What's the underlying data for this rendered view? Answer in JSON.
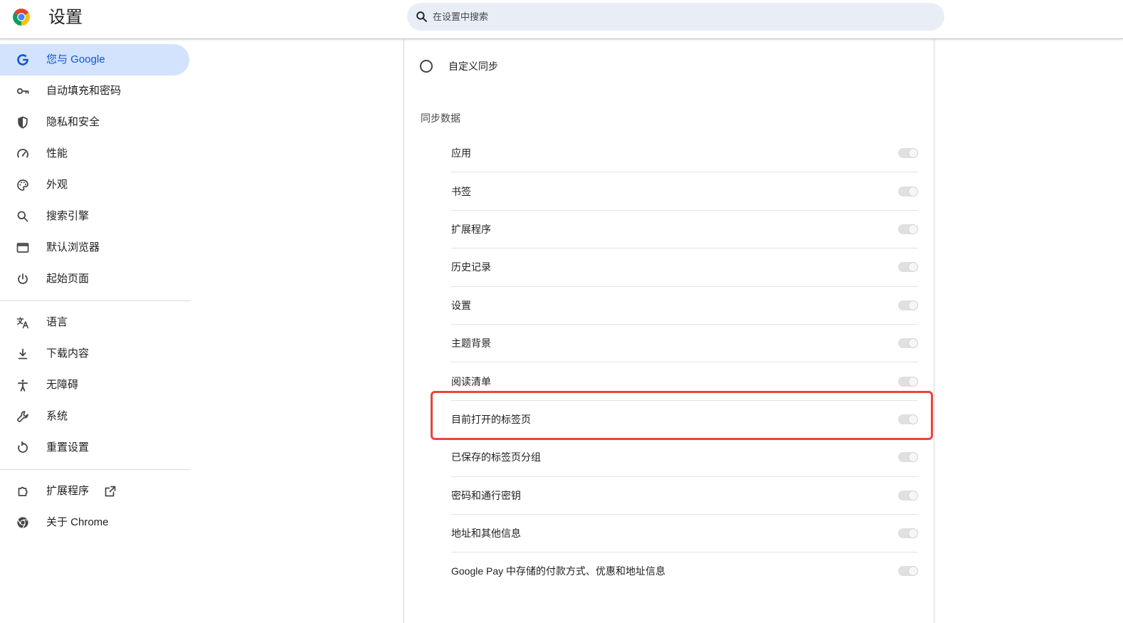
{
  "header": {
    "logo_icon": "chrome-logo-icon",
    "title": "设置",
    "search_icon": "search-icon",
    "search_placeholder": "在设置中搜索"
  },
  "sidebar": {
    "primary": [
      {
        "label": "您与 Google",
        "icon": "google-g-icon",
        "selected": true
      },
      {
        "label": "自动填充和密码",
        "icon": "key-icon",
        "selected": false
      },
      {
        "label": "隐私和安全",
        "icon": "shield-icon",
        "selected": false
      },
      {
        "label": "性能",
        "icon": "gauge-icon",
        "selected": false
      },
      {
        "label": "外观",
        "icon": "palette-icon",
        "selected": false
      },
      {
        "label": "搜索引擎",
        "icon": "search-icon",
        "selected": false
      },
      {
        "label": "默认浏览器",
        "icon": "browser-window-icon",
        "selected": false
      },
      {
        "label": "起始页面",
        "icon": "power-icon",
        "selected": false
      }
    ],
    "secondary": [
      {
        "label": "语言",
        "icon": "translate-icon"
      },
      {
        "label": "下载内容",
        "icon": "download-icon"
      },
      {
        "label": "无障碍",
        "icon": "accessibility-icon"
      },
      {
        "label": "系统",
        "icon": "wrench-icon"
      },
      {
        "label": "重置设置",
        "icon": "reset-icon"
      }
    ],
    "tertiary": [
      {
        "label": "扩展程序",
        "icon": "puzzle-icon",
        "trailing_icon": "external-link-icon"
      },
      {
        "label": "关于 Chrome",
        "icon": "chrome-icon"
      }
    ]
  },
  "sync": {
    "custom_sync": {
      "label": "自定义同步",
      "selected": false
    },
    "data_heading": "同步数据",
    "items": [
      {
        "label": "应用",
        "checked": true,
        "disabled": true
      },
      {
        "label": "书签",
        "checked": true,
        "disabled": true
      },
      {
        "label": "扩展程序",
        "checked": true,
        "disabled": true
      },
      {
        "label": "历史记录",
        "checked": true,
        "disabled": true
      },
      {
        "label": "设置",
        "checked": true,
        "disabled": true
      },
      {
        "label": "主题背景",
        "checked": true,
        "disabled": true
      },
      {
        "label": "阅读清单",
        "checked": true,
        "disabled": true
      },
      {
        "label": "目前打开的标签页",
        "checked": true,
        "disabled": true
      },
      {
        "label": "已保存的标签页分组",
        "checked": true,
        "disabled": true
      },
      {
        "label": "密码和通行密钥",
        "checked": true,
        "disabled": true
      },
      {
        "label": "地址和其他信息",
        "checked": true,
        "disabled": true
      },
      {
        "label": "Google Pay 中存储的付款方式、优惠和地址信息",
        "checked": true,
        "disabled": true
      }
    ],
    "highlighted_index": 7
  },
  "colors": {
    "accent": "#0b57d0",
    "selected_background": "#d3e3fd",
    "search_background": "#e9eef6",
    "highlight_border": "#e8453c",
    "toggle_disabled": "#e0e0e0"
  }
}
